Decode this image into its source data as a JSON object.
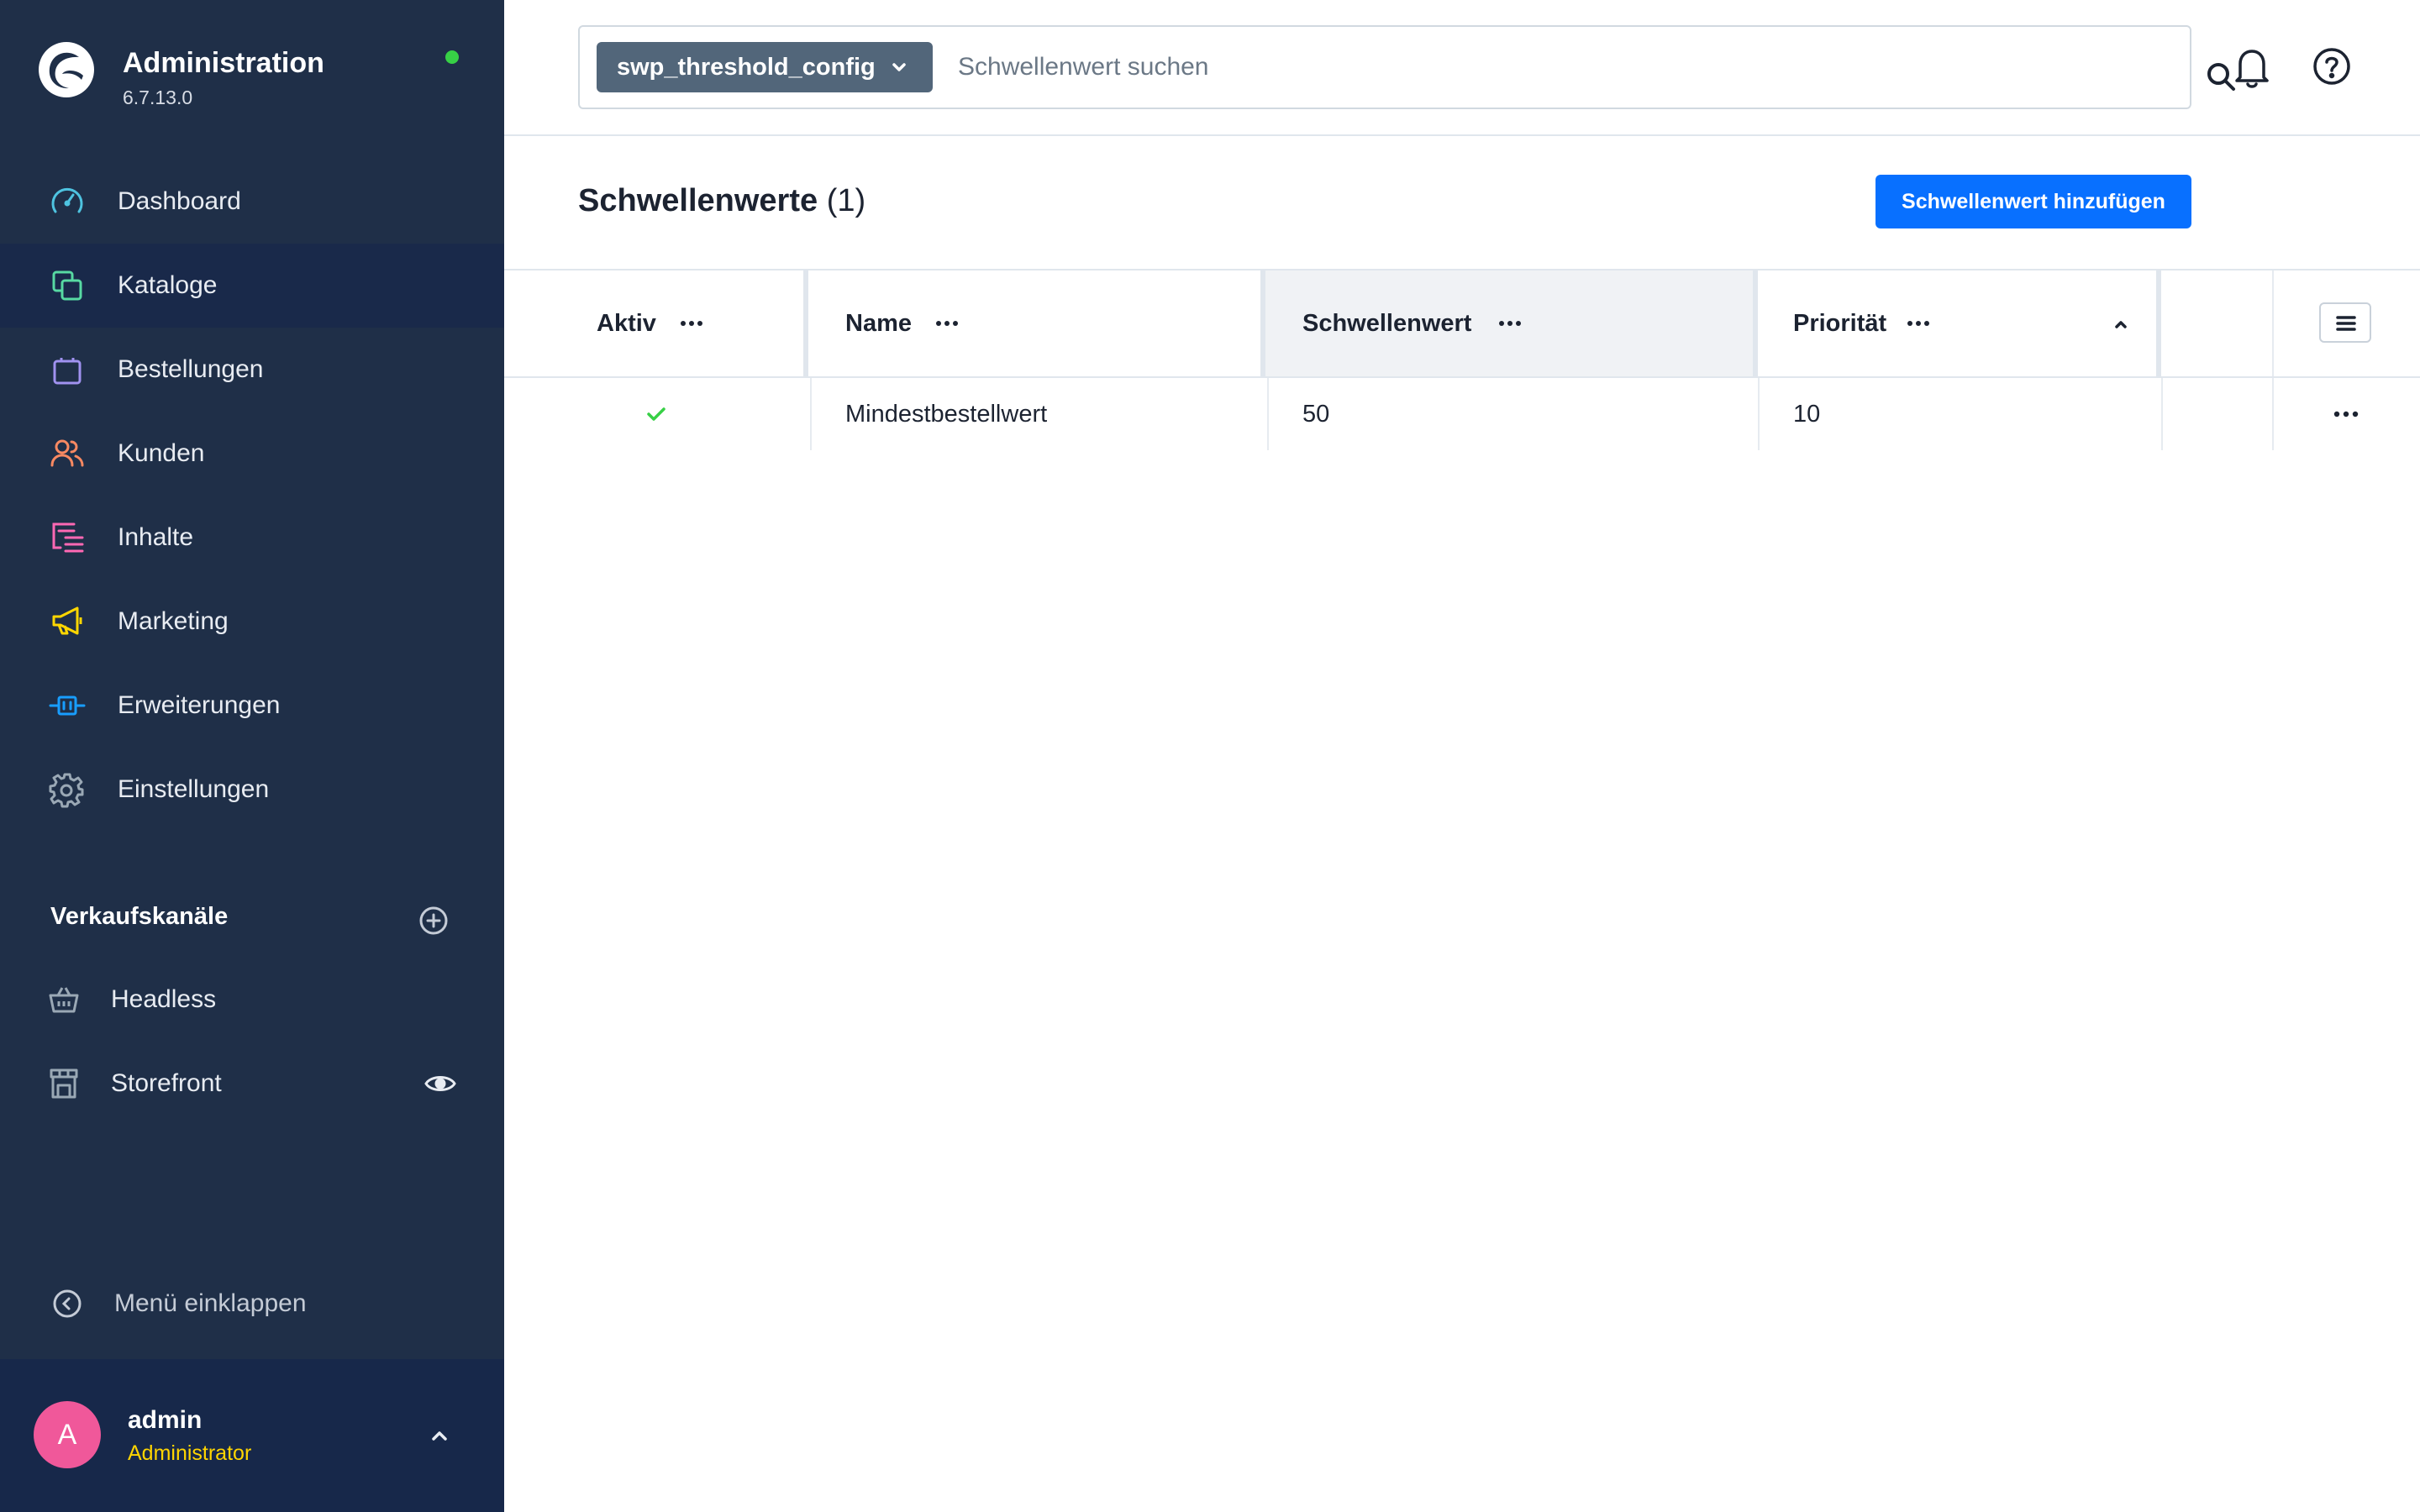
{
  "app": {
    "title": "Administration",
    "version": "6.7.13.0",
    "status_color": "#37d046"
  },
  "sidebar": {
    "items": [
      {
        "label": "Dashboard",
        "icon": "dashboard-icon",
        "color": "#4ec3e0",
        "active": false
      },
      {
        "label": "Kataloge",
        "icon": "catalog-icon",
        "color": "#57d9a3",
        "active": true
      },
      {
        "label": "Bestellungen",
        "icon": "shopping-bag-icon",
        "color": "#a092f0",
        "active": false
      },
      {
        "label": "Kunden",
        "icon": "customers-icon",
        "color": "#f88962",
        "active": false
      },
      {
        "label": "Inhalte",
        "icon": "content-icon",
        "color": "#ff68b4",
        "active": false
      },
      {
        "label": "Marketing",
        "icon": "megaphone-icon",
        "color": "#ffd700",
        "active": false
      },
      {
        "label": "Erweiterungen",
        "icon": "plug-icon",
        "color": "#189eff",
        "active": false
      },
      {
        "label": "Einstellungen",
        "icon": "gear-icon",
        "color": "#9aa8b5",
        "active": false
      }
    ],
    "sales_channels": {
      "title": "Verkaufskanäle",
      "items": [
        {
          "label": "Headless",
          "icon": "basket-icon"
        },
        {
          "label": "Storefront",
          "icon": "storefront-icon"
        }
      ]
    },
    "collapse_label": "Menü einklappen",
    "user": {
      "initial": "A",
      "name": "admin",
      "role": "Administrator"
    }
  },
  "topbar": {
    "entity": "swp_threshold_config",
    "search_placeholder": "Schwellenwert suchen"
  },
  "main": {
    "title": "Schwellenwerte",
    "count": "(1)",
    "add_button": "Schwellenwert hinzufügen",
    "columns": [
      {
        "label": "Aktiv"
      },
      {
        "label": "Name"
      },
      {
        "label": "Schwellenwert"
      },
      {
        "label": "Priorität"
      }
    ],
    "rows": [
      {
        "active": true,
        "name": "Mindestbestellwert",
        "threshold": "50",
        "priority": "10"
      }
    ]
  },
  "colors": {
    "sidebar_bg": "#1f2f48",
    "primary": "#0870ff",
    "check": "#37d046",
    "avatar": "#f0589a",
    "role": "#ffd500"
  }
}
